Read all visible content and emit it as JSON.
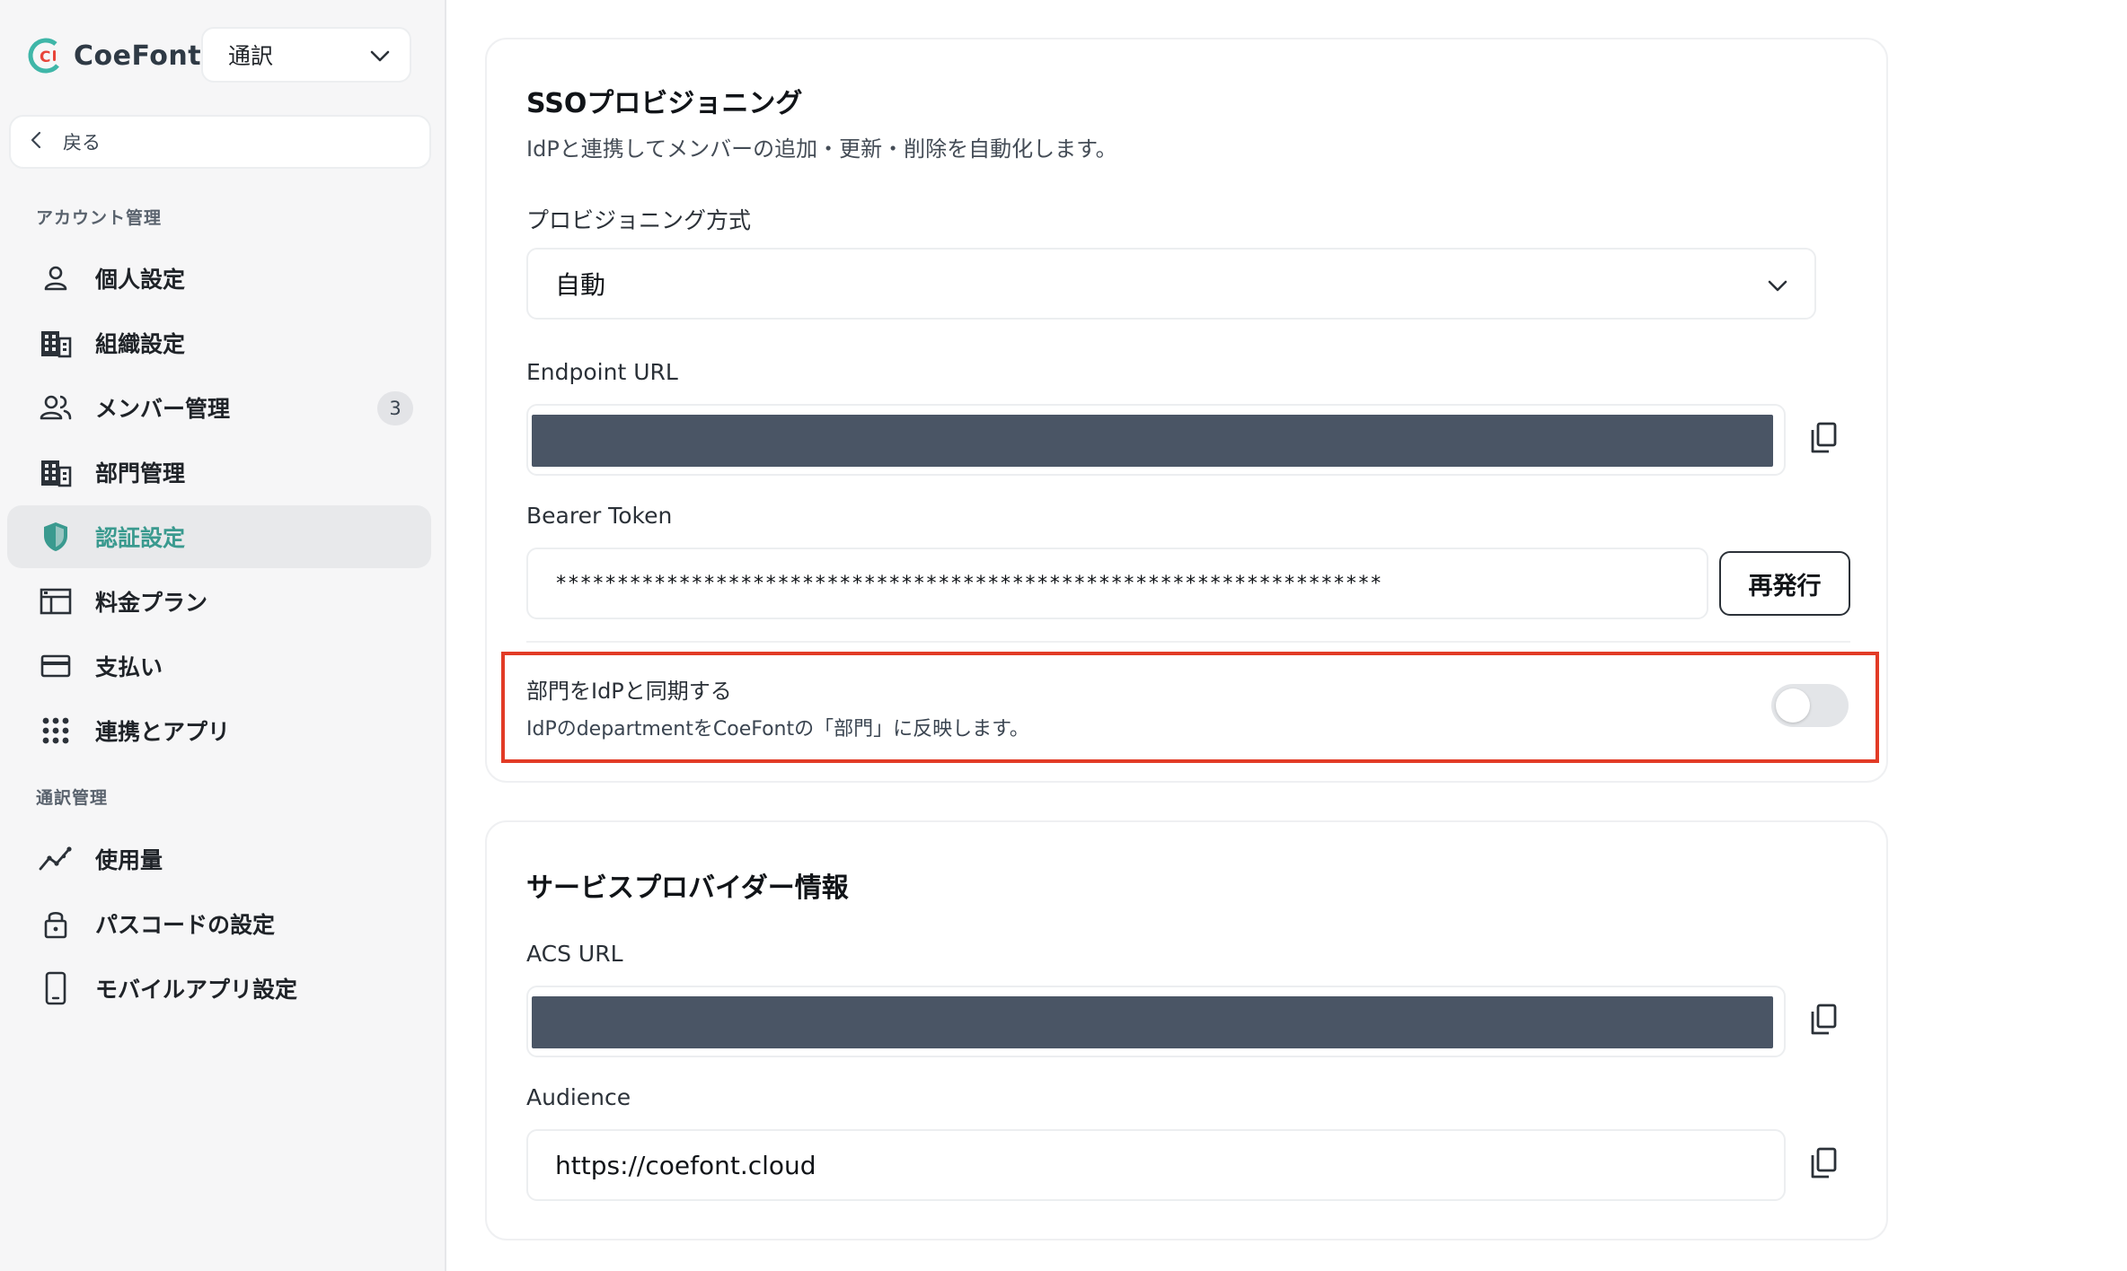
{
  "app": {
    "name": "CoeFont",
    "mode_select": "通訳",
    "back_label": "戻る"
  },
  "sidebar": {
    "section_account": "アカウント管理",
    "section_interp": "通訳管理",
    "items": [
      {
        "label": "個人設定",
        "icon": "user-icon"
      },
      {
        "label": "組織設定",
        "icon": "building-icon"
      },
      {
        "label": "メンバー管理",
        "icon": "users-icon",
        "badge": "3"
      },
      {
        "label": "部門管理",
        "icon": "building-icon"
      },
      {
        "label": "認証設定",
        "icon": "shield-icon",
        "active": true
      },
      {
        "label": "料金プラン",
        "icon": "plan-icon"
      },
      {
        "label": "支払い",
        "icon": "credit-card-icon"
      },
      {
        "label": "連携とアプリ",
        "icon": "grid-icon"
      },
      {
        "label": "使用量",
        "icon": "chart-line-icon"
      },
      {
        "label": "パスコードの設定",
        "icon": "lock-icon"
      },
      {
        "label": "モバイルアプリ設定",
        "icon": "mobile-icon"
      }
    ]
  },
  "sso": {
    "title": "SSOプロビジョニング",
    "subtitle": "IdPと連携してメンバーの追加・更新・削除を自動化します。",
    "method_label": "プロビジョニング方式",
    "method_value": "自動",
    "endpoint_label": "Endpoint URL",
    "token_label": "Bearer Token",
    "token_value": "*******************************************************************",
    "reissue_label": "再発行",
    "sync_title": "部門をIdPと同期する",
    "sync_desc": "IdPのdepartmentをCoeFontの「部門」に反映します。",
    "sync_enabled": false
  },
  "sp": {
    "title": "サービスプロバイダー情報",
    "acs_label": "ACS URL",
    "audience_label": "Audience",
    "audience_value": "https://coefont.cloud"
  },
  "colors": {
    "accent": "#3a9a8f",
    "logo_red": "#e8443a",
    "logo_teal": "#3fb6a8",
    "highlight": "#e23b26",
    "mask": "#4a5565"
  }
}
